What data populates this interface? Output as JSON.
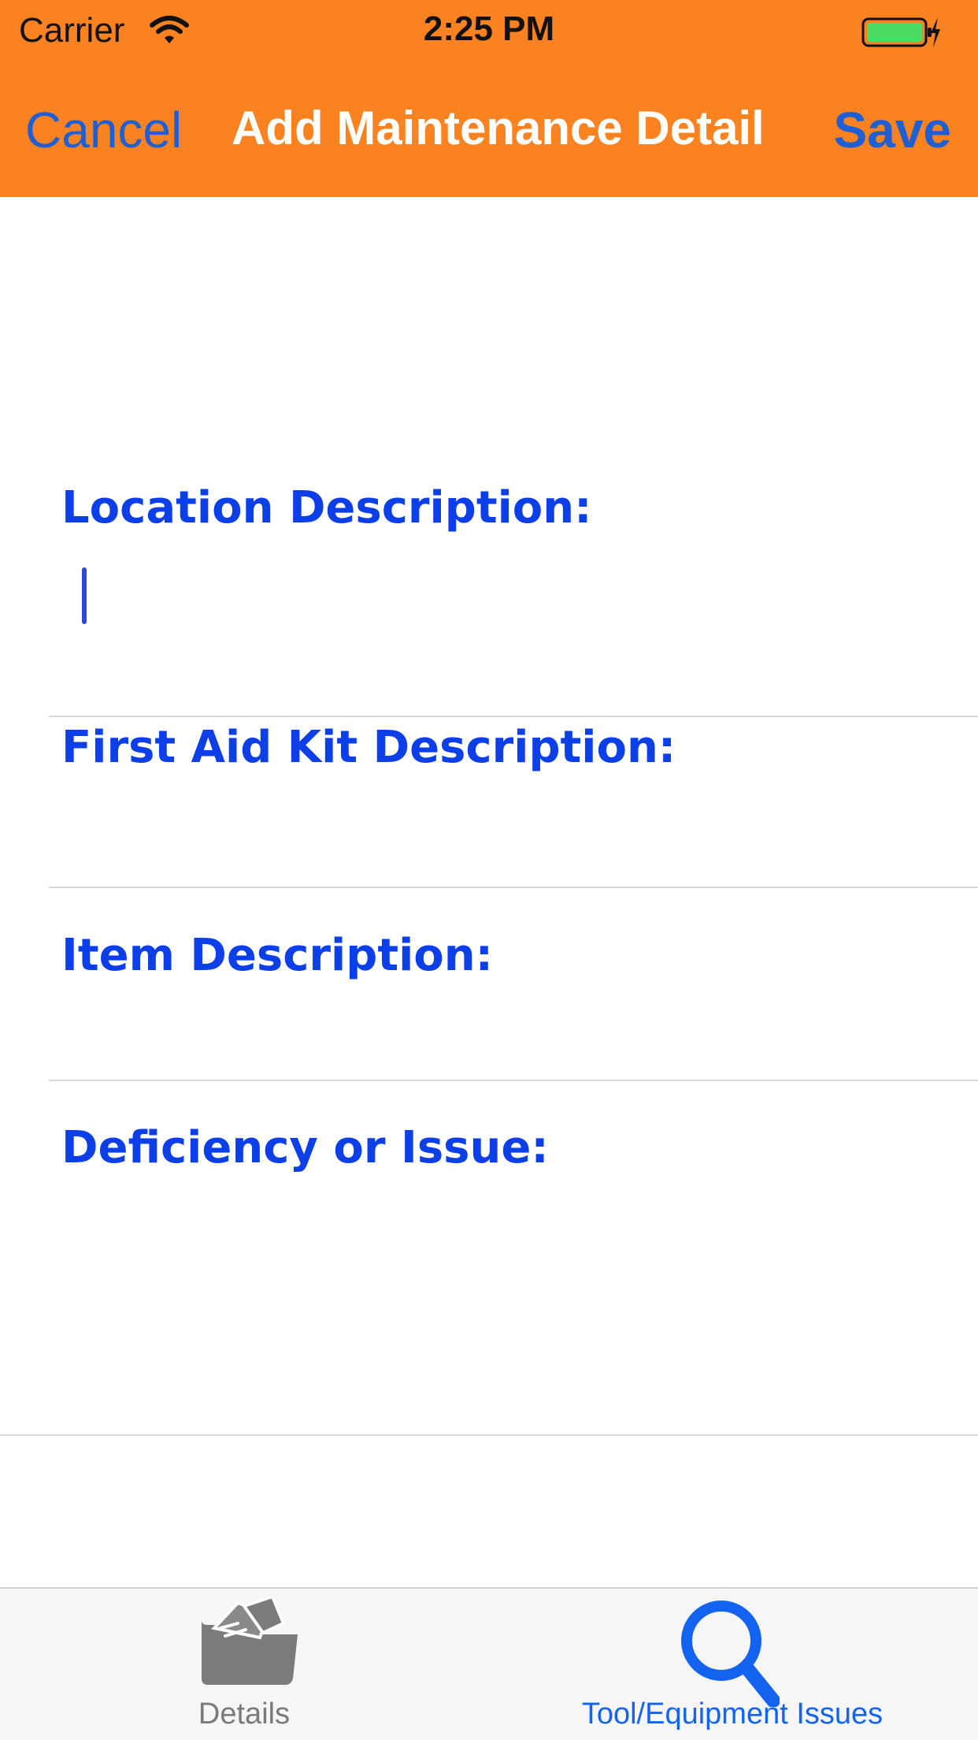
{
  "status_bar": {
    "carrier": "Carrier",
    "time": "2:25 PM",
    "wifi_icon": "wifi-icon",
    "battery_icon": "battery-charging-icon",
    "battery_color": "#4cd964"
  },
  "nav_bar": {
    "cancel_label": "Cancel",
    "title": "Add Maintenance Detail",
    "save_label": "Save",
    "background_color": "#fb8221",
    "button_color": "#1f5fd6"
  },
  "form": {
    "label_color": "#0c3fe8",
    "fields": [
      {
        "label": "Location Description:",
        "value": ""
      },
      {
        "label": "First Aid Kit Description:",
        "value": ""
      },
      {
        "label": "Item Description:",
        "value": ""
      },
      {
        "label": "Deficiency or Issue:",
        "value": ""
      }
    ]
  },
  "tab_bar": {
    "tabs": [
      {
        "label": "Details",
        "icon": "folder-icon",
        "selected": false
      },
      {
        "label": "Tool/Equipment Issues",
        "icon": "magnifying-glass-icon",
        "selected": true
      }
    ],
    "selected_color": "#1363f0",
    "unselected_color": "#7a7a7a"
  }
}
